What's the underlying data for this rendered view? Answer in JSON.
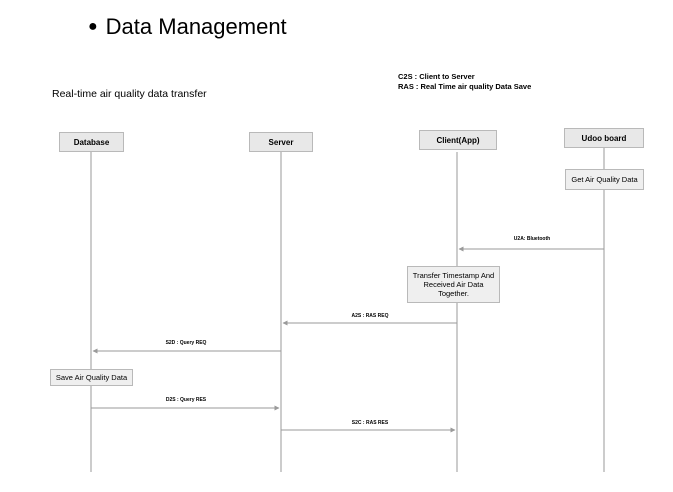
{
  "slide_title": "Data Management",
  "subtitle": "Real-time air quality data transfer",
  "legend": [
    "C2S : Client to Server",
    "RAS : Real Time air quality Data Save"
  ],
  "actors": {
    "database": "Database",
    "server": "Server",
    "client": "Client(App)",
    "udoo": "Udoo board"
  },
  "notes": {
    "get_air_quality": "Get Air Quality Data",
    "transfer_timestamp": "Transfer Timestamp And Received  Air Data Together.",
    "save_air_quality": "Save Air Quality Data"
  },
  "messages": {
    "u2a": "U2A: Bluetooth",
    "a2s": "A2S : RAS REQ",
    "s2d": "S2D : Query REQ",
    "d2s": "D2S : Query RES",
    "s2c": "S2C : RAS RES"
  },
  "colors": {
    "line": "#9a9a9a",
    "box_fill": "#e8e8e8",
    "box_border": "#b9b9b9"
  }
}
